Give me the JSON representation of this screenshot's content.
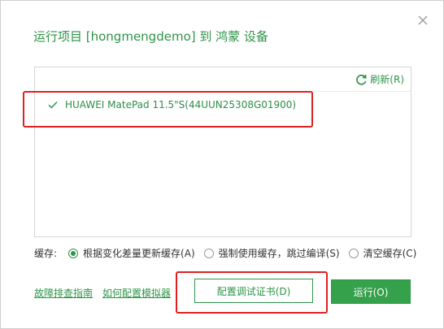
{
  "dialog": {
    "title": "运行项目 [hongmengdemo] 到 鸿蒙 设备",
    "close_icon": "close-icon"
  },
  "device_list": {
    "refresh_label": "刷新(R)",
    "devices": [
      {
        "name": "HUAWEI MatePad 11.5\"S(44UUN25308G01900)",
        "checked": true
      }
    ]
  },
  "cache": {
    "label": "缓存:",
    "options": [
      {
        "label": "根据变化差量更新缓存(A)",
        "selected": true
      },
      {
        "label": "强制使用缓存，跳过编译(S)",
        "selected": false
      },
      {
        "label": "清空缓存(C)",
        "selected": false
      }
    ]
  },
  "footer": {
    "troubleshoot_link": "故障排查指南",
    "emulator_link": "如何配置模拟器",
    "cert_button": "配置调试证书(D)",
    "run_button": "运行(O)"
  },
  "colors": {
    "accent": "#2e9448",
    "run_button_bg": "#35a14a",
    "highlight_red": "#e02020"
  }
}
